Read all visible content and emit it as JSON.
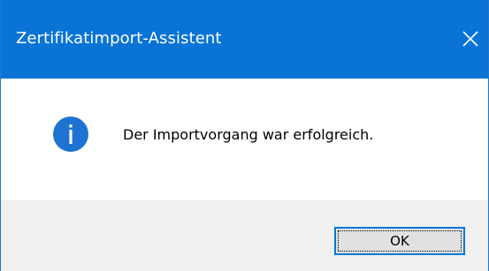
{
  "window": {
    "title": "Zertifikatimport-Assistent",
    "close_glyph": "✕"
  },
  "dialog": {
    "icon": "info-icon",
    "message": "Der Importvorgang war erfolgreich."
  },
  "buttons": {
    "ok_label": "OK"
  },
  "colors": {
    "titlebar": "#0a74d6",
    "info_icon": "#1e73d2",
    "footer": "#f0f0f0",
    "button_border": "#0078d7"
  }
}
